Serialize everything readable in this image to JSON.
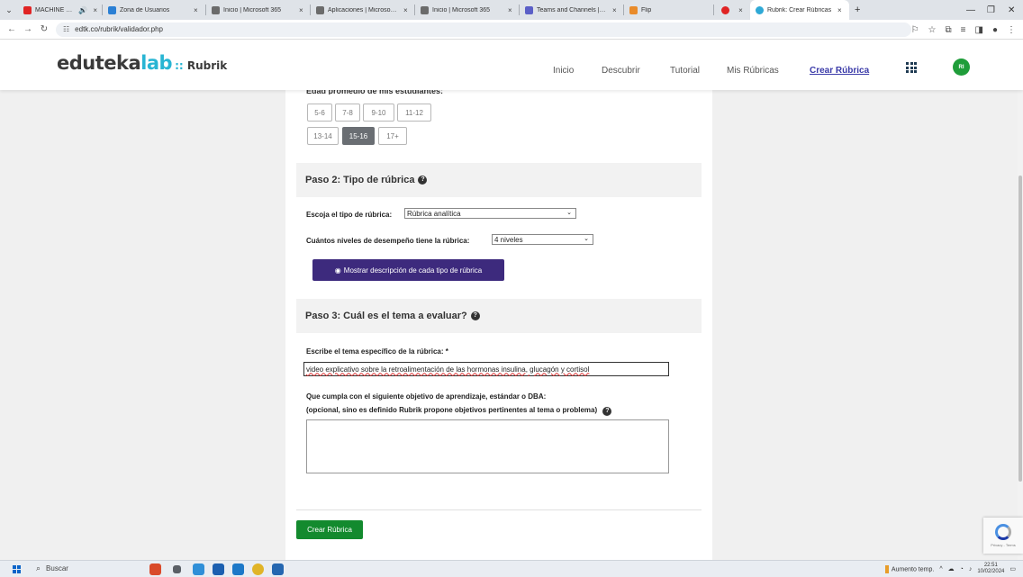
{
  "browser": {
    "tabs": [
      {
        "title": "MACHINE HEAD - Th",
        "favicon_color": "#e02424"
      },
      {
        "title": "Zona de Usuarios",
        "favicon_color": "#2a7fd4"
      },
      {
        "title": "Inicio | Microsoft 365",
        "favicon_color": "#6b6b6b"
      },
      {
        "title": "Aplicaciones | Microsoft 3",
        "favicon_color": "#6b6b6b"
      },
      {
        "title": "Inicio | Microsoft 365",
        "favicon_color": "#6b6b6b"
      },
      {
        "title": "Teams and Channels | Go",
        "favicon_color": "#5b5fc7"
      },
      {
        "title": "Flip",
        "favicon_color": "#e98b2a"
      },
      {
        "title": "",
        "favicon_color": "#e02424"
      },
      {
        "title": "Rubrik: Crear Rúbricas",
        "favicon_color": "#2fa9d6"
      }
    ],
    "new_tab": "+",
    "url": "edtk.co/rubrik/validador.php"
  },
  "header": {
    "logo_edu": "eduteka",
    "logo_lab": "lab",
    "logo_sep": "::",
    "logo_product": "Rubrik",
    "nav": [
      {
        "label": "Inicio"
      },
      {
        "label": "Descubrir"
      },
      {
        "label": "Tutorial"
      },
      {
        "label": "Mis Rúbricas"
      },
      {
        "label": "Crear Rúbrica"
      }
    ],
    "avatar_initials": "RI",
    "avatar_color": "#1f9d3a"
  },
  "age": {
    "label": "Edad promedio de mis estudiantes:",
    "options_row1": [
      "5-6",
      "7-8",
      "9-10",
      "11-12"
    ],
    "options_row2": [
      "13-14",
      "15-16",
      "17+"
    ],
    "selected": "15-16"
  },
  "step2": {
    "title": "Paso 2: Tipo de rúbrica",
    "type_label": "Escoja el tipo de rúbrica:",
    "type_value": "Rúbrica analítica",
    "levels_label": "Cuántos niveles de desempeño tiene la rúbrica:",
    "levels_value": "4 niveles",
    "show_desc_button": "Mostrar descripción de cada tipo de rúbrica"
  },
  "step3": {
    "title": "Paso 3: Cuál es el tema a evaluar?",
    "topic_label": "Escribe el tema específico de la rúbrica: *",
    "topic_value": "video explicativo sobre la retroalimentación de las hormonas insulina, glucagón y cortisol",
    "objective_label_1": "Que cumpla con el siguiente objetivo de aprendizaje, estándar o DBA:",
    "objective_label_2": "(opcional, sino es definido Rubrik propone objetivos pertinentes al tema o problema)",
    "objective_value": ""
  },
  "submit_button": "Crear Rúbrica",
  "recaptcha_text": "Privacy - Terms",
  "colors": {
    "purple_button": "#3d2a7d",
    "green_button": "#138a2e",
    "accent_blue": "#28b5d3",
    "selected_age": "#6a6e73"
  },
  "taskbar": {
    "search_placeholder": "Buscar",
    "weather": "Aumento temp.",
    "time": "22:51",
    "date": "10/02/2024"
  }
}
